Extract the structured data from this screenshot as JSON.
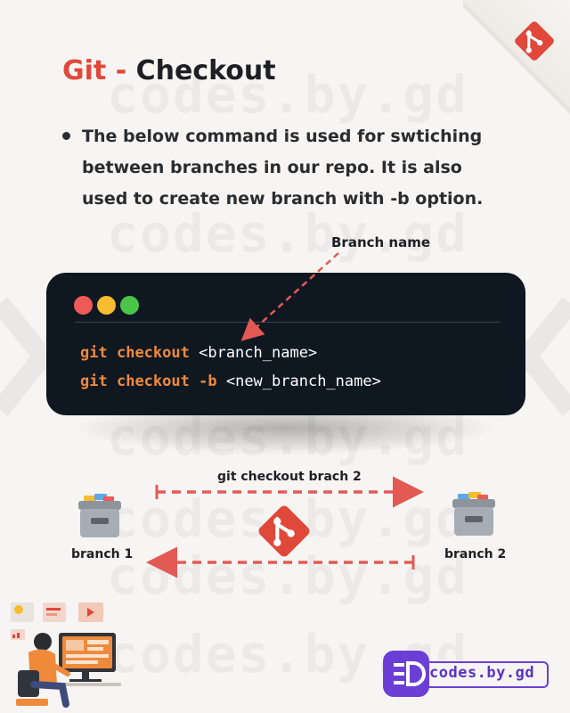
{
  "header": {
    "title_accent": "Git - ",
    "title_main": "Checkout"
  },
  "description": {
    "bullet": "The below command is used for swtiching between branches in our repo. It is also used to create new branch with -b option."
  },
  "annotation": {
    "branch_name_label": "Branch name"
  },
  "terminal": {
    "lines": [
      {
        "cmd": "git",
        "sub": "checkout",
        "flag": "",
        "arg": "<branch_name>"
      },
      {
        "cmd": "git",
        "sub": "checkout",
        "flag": "-b",
        "arg": "<new_branch_name>"
      }
    ]
  },
  "diagram": {
    "switch_label": "git checkout brach 2",
    "left_branch": "branch 1",
    "right_branch": "branch 2"
  },
  "watermark": "codes.by.gd",
  "brand": {
    "name": "codes.by.gd",
    "badge_text": "≡D"
  },
  "colors": {
    "accent": "#e0483a",
    "terminal_bg": "#0f1721",
    "keyword": "#f08a3b",
    "brand": "#6b3fd6",
    "arrow": "#e35a55"
  },
  "icons": {
    "corner_logo": "git-logo-icon",
    "center_logo": "git-logo-icon",
    "branch_box": "archive-box-icon"
  }
}
